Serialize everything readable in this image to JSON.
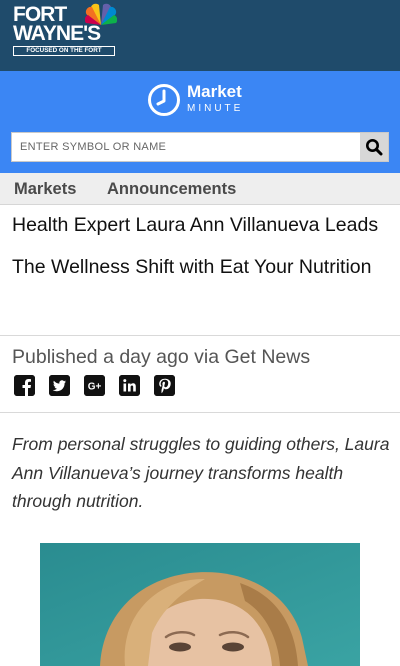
{
  "header": {
    "logo_line1": "FORT",
    "logo_line2": "WAYNE'S",
    "logo_tagline": "FOCUSED ON THE FORT"
  },
  "market_minute": {
    "title": "Market",
    "subtitle": "MINUTE",
    "clock_icon": "clock-icon"
  },
  "search": {
    "placeholder": "ENTER SYMBOL OR NAME",
    "button_icon": "search-icon"
  },
  "tabs": [
    {
      "label": "Markets"
    },
    {
      "label": "Announcements"
    }
  ],
  "article": {
    "title": "Health Expert Laura Ann Villanueva Leads The Wellness Shift with Eat Your Nutrition",
    "published": "Published a day ago via Get News",
    "summary": "From personal struggles to guiding others, Laura Ann Villanueva’s journey transforms health through nutrition.",
    "image": "woman-portrait-photo"
  },
  "social": [
    {
      "name": "facebook-icon",
      "glyph": "f"
    },
    {
      "name": "twitter-icon",
      "glyph": "t"
    },
    {
      "name": "googleplus-icon",
      "glyph": "G+"
    },
    {
      "name": "linkedin-icon",
      "glyph": "in"
    },
    {
      "name": "pinterest-icon",
      "glyph": "P"
    }
  ],
  "colors": {
    "header_bg": "#1f4b6b",
    "market_minute_bg": "#3b86f4",
    "tabs_bg": "#eeeeee",
    "photo_bg": "#2f8f92"
  }
}
